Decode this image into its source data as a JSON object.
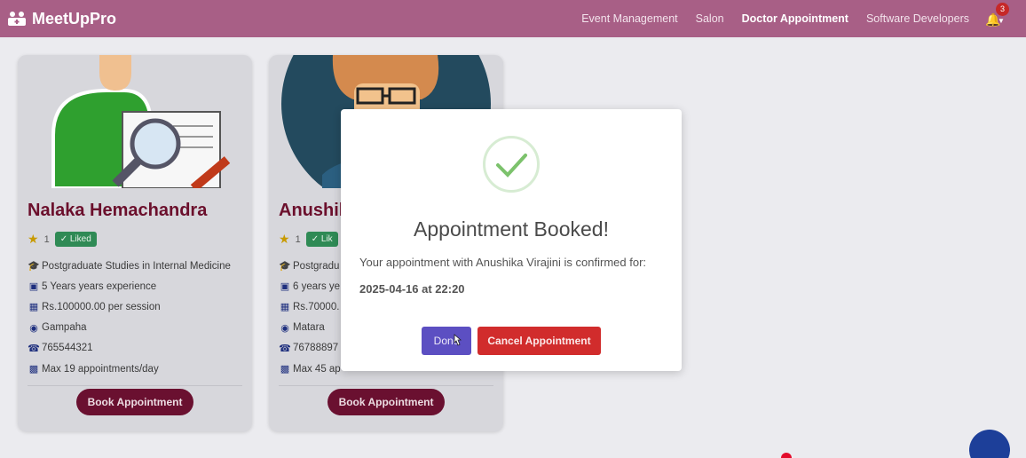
{
  "app": {
    "brand": "MeetUpPro"
  },
  "nav": {
    "links": [
      "Event Management",
      "Salon",
      "Doctor Appointment",
      "Software Developers"
    ],
    "notifications_count": "3"
  },
  "cards": [
    {
      "name": "Nalaka Hemachandra",
      "rating": "1",
      "liked_label": "Liked",
      "specialization": "Postgraduate Studies in Internal Medicine",
      "experience": "5 Years years experience",
      "fee": "Rs.100000.00 per session",
      "location": "Gampaha",
      "phone": "765544321",
      "max_appointments": "Max 19 appointments/day",
      "button": "Book Appointment"
    },
    {
      "name": "Anushil",
      "rating": "1",
      "liked_label": "Lik",
      "specialization": "Postgradu",
      "experience": "6 years ye",
      "fee": "Rs.70000.",
      "location": "Matara",
      "phone": "76788897",
      "max_appointments": "Max 45 ap",
      "button": "Book Appointment"
    }
  ],
  "modal": {
    "title": "Appointment Booked!",
    "text": "Your appointment with Anushika Virajini is confirmed for:",
    "datetime": "2025-04-16 at 22:20",
    "done": "Done",
    "cancel": "Cancel Appointment"
  },
  "colors": {
    "navbar": "#a85f86",
    "doctor_name": "#6b0f2c",
    "book_button": "#6a1030",
    "done_button": "#5c4fc2",
    "cancel_button": "#d12c2c",
    "liked_badge": "#2f8a55"
  },
  "icons": [
    "doctor-logo-icon",
    "bell-icon",
    "star-icon",
    "check-icon",
    "graduation-cap-icon",
    "briefcase-icon",
    "money-icon",
    "location-pin-icon",
    "phone-icon",
    "calendar-icon",
    "success-check-icon",
    "chat-icon"
  ]
}
